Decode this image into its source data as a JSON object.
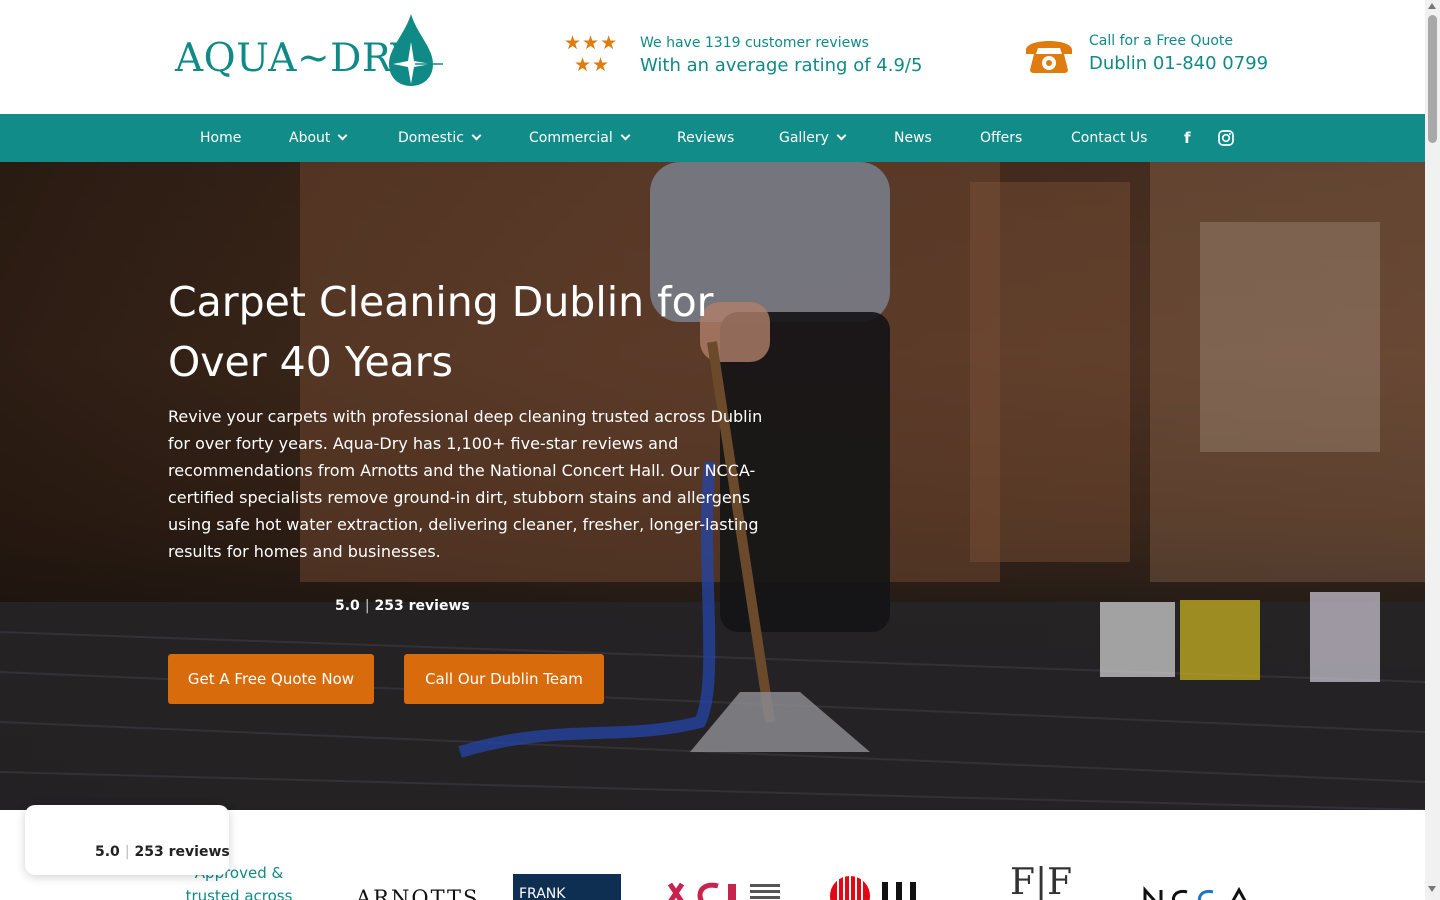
{
  "header": {
    "logo_text": "AQUA~DRY",
    "review_stars": "★★★",
    "review_stars_row2": "★★",
    "review_line1": "We have 1319 customer reviews",
    "review_line2": "With an average rating of 4.9/5",
    "phone_line1": "Call for a Free Quote",
    "phone_line2": "Dublin 01-840 0799"
  },
  "nav": {
    "items": [
      {
        "label": "Home"
      },
      {
        "label": "About"
      },
      {
        "label": "Domestic"
      },
      {
        "label": "Commercial"
      },
      {
        "label": "Reviews"
      },
      {
        "label": "Gallery"
      },
      {
        "label": "News"
      },
      {
        "label": "Offers"
      },
      {
        "label": "Contact Us"
      }
    ],
    "social": {
      "facebook": "f",
      "instagram": "◎"
    }
  },
  "hero": {
    "title": "Carpet Cleaning Dublin for Over 40 Years",
    "text": "Revive your carpets with professional deep cleaning trusted across Dublin for over forty years. Aqua-Dry has 1,100+ five-star reviews and recommendations from Arnotts and the National Concert Hall. Our NCCA-certified specialists remove ground-in dirt, stubborn stains and allergens using safe hot water extraction, delivering cleaner, fresher, longer-lasting results for homes and businesses.",
    "rating_score": "5.0",
    "rating_reviews": "253 reviews",
    "btn_quote": "Get A Free Quote Now",
    "btn_call": "Call Our Dublin Team"
  },
  "partners": {
    "approved_text": "Approved & trusted across",
    "arnotts": "ARNOTTS",
    "frank": "FRANK",
    "ff": "F|F"
  },
  "rating_card": {
    "score": "5.0",
    "reviews": "253 reviews"
  },
  "colors": {
    "brand_teal": "#118c89",
    "accent_orange": "#d86c0c",
    "star_orange": "#e07b10"
  }
}
